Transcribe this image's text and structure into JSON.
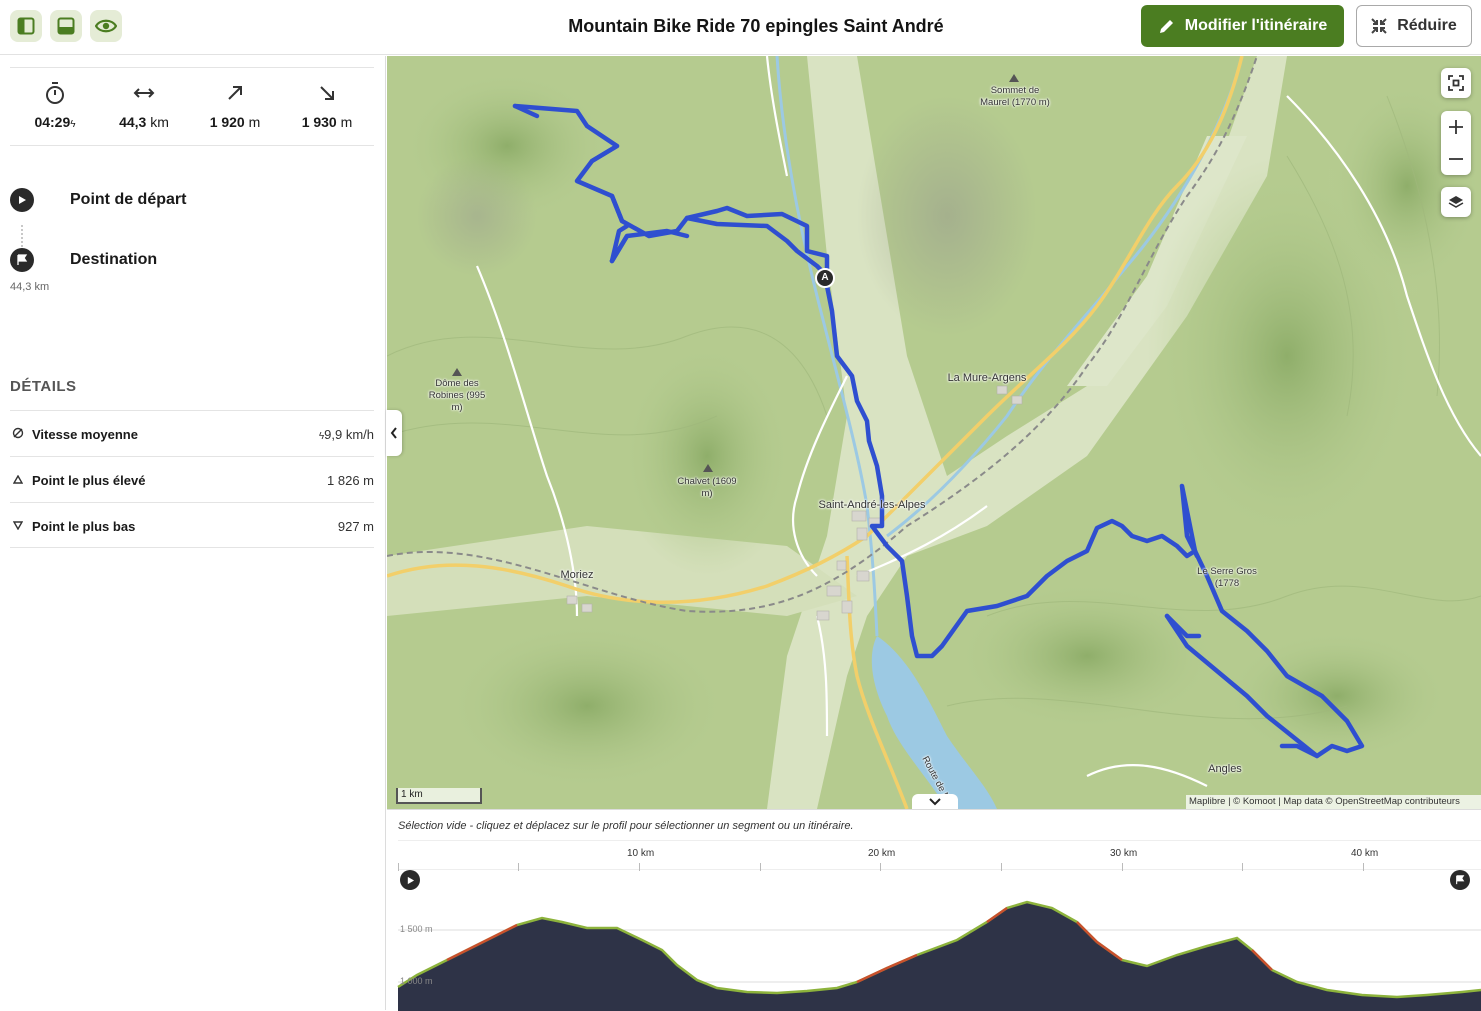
{
  "header": {
    "title": "Mountain Bike Ride 70 epingles Saint André",
    "edit_label": "Modifier l'itinéraire",
    "reduce_label": "Réduire"
  },
  "stats": {
    "duration": "04:29",
    "distance": "44,3",
    "distance_unit": "km",
    "ascent": "1 920",
    "ascent_unit": "m",
    "descent": "1 930",
    "descent_unit": "m"
  },
  "waypoints": {
    "start_label": "Point de départ",
    "destination_label": "Destination",
    "distance_note": "44,3 km"
  },
  "details": {
    "title": "DÉTAILS",
    "rows": [
      {
        "label": "Vitesse moyenne",
        "value": "9,9 km/h"
      },
      {
        "label": "Point le plus élevé",
        "value": "1 826 m"
      },
      {
        "label": "Point le plus bas",
        "value": "927 m"
      }
    ]
  },
  "map": {
    "labels": {
      "sommet_maurel": "Sommet de Maurel (1770 m)",
      "la_mure": "La Mure-Argens",
      "dome_robines": "Dôme des Robines (995 m)",
      "chalvet": "Chalvet (1609 m)",
      "saint_andre": "Saint-André-les-Alpes",
      "moriez": "Moriez",
      "serre_gros": "Le Serre Gros (1778",
      "angles": "Angles",
      "route": "Route de N..."
    },
    "marker_letter": "A",
    "scale": "1 km",
    "attribution": "Maplibre | © Komoot | Map data © OpenStreetMap contributeurs",
    "route_color": "#2f4fd0"
  },
  "profile": {
    "hint": "Sélection vide - cliquez et déplacez sur le profil pour sélectionner un segment ou un itinéraire.",
    "km_ticks": [
      "10 km",
      "20 km",
      "30 km",
      "40 km"
    ],
    "elev_ticks": [
      "1 500 m",
      "1 000 m"
    ]
  },
  "colors": {
    "accent": "#4b7d21",
    "profile_fill": "#2e3347"
  }
}
